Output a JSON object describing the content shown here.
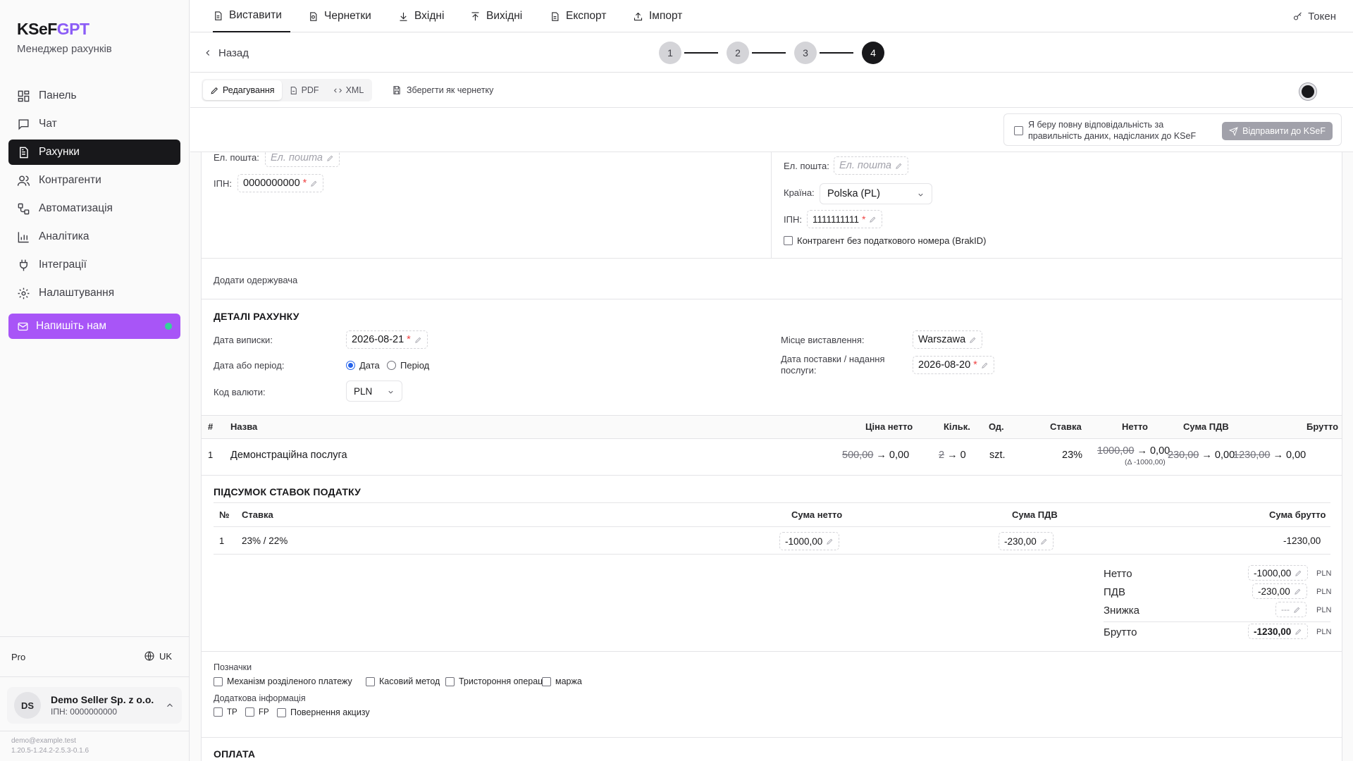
{
  "brand": {
    "name_a": "KSeF",
    "name_b": "GPT",
    "subtitle": "Менеджер рахунків"
  },
  "nav": {
    "items": [
      {
        "label": "Панель",
        "icon": "dashboard-icon"
      },
      {
        "label": "Чат",
        "icon": "chat-icon"
      },
      {
        "label": "Рахунки",
        "icon": "invoice-icon",
        "active": true
      },
      {
        "label": "Контрагенти",
        "icon": "users-icon"
      },
      {
        "label": "Автоматизація",
        "icon": "workflow-icon"
      },
      {
        "label": "Аналітика",
        "icon": "chart-icon"
      },
      {
        "label": "Інтеграції",
        "icon": "plug-icon"
      },
      {
        "label": "Налаштування",
        "icon": "gear-icon"
      }
    ],
    "write_us": "Напишіть нам"
  },
  "sidebar_footer": {
    "plan": "Pro",
    "lang": "UK",
    "account_initials": "DS",
    "account_name": "Demo Seller Sp. z o.o.",
    "account_tax": "ІПН: 0000000000",
    "email": "demo@example.test",
    "version": "1.20.5-1.24.2-2.5.3-0.1.6"
  },
  "tabs": [
    {
      "label": "Виставити",
      "active": true
    },
    {
      "label": "Чернетки"
    },
    {
      "label": "Вхідні"
    },
    {
      "label": "Вихідні"
    },
    {
      "label": "Експорт"
    },
    {
      "label": "Імпорт"
    }
  ],
  "token_label": "Токен",
  "back_label": "Назад",
  "steps": [
    "1",
    "2",
    "3",
    "4"
  ],
  "current_step": 4,
  "view": {
    "edit": "Редагування",
    "pdf": "PDF",
    "xml": "XML",
    "save_draft": "Зберегти як чернетку"
  },
  "action": {
    "responsibility": "Я беру повну відповідальність за правильність даних, надісланих до KSeF",
    "send": "Відправити до KSeF"
  },
  "seller": {
    "email_label": "Ел. пошта:",
    "email_placeholder": "Ел. пошта",
    "tax_label": "ІПН:",
    "tax_value": "0000000000"
  },
  "buyer": {
    "email_label": "Ел. пошта:",
    "email_placeholder": "Ел. пошта",
    "country_label": "Країна:",
    "country_value": "Polska (PL)",
    "tax_label": "ІПН:",
    "tax_value": "1111111111",
    "no_tax_label": "Контрагент без податкового номера (BrakID)"
  },
  "add_recipient": "Додати одержувача",
  "details": {
    "title": "ДЕТАЛІ РАХУНКУ",
    "issue_date_label": "Дата виписки:",
    "issue_date": "2026-08-21",
    "date_or_period_label": "Дата або період:",
    "opt_date": "Дата",
    "opt_period": "Період",
    "currency_label": "Код валюти:",
    "currency": "PLN",
    "place_label": "Місце виставлення:",
    "place": "Warszawa",
    "delivery_label_1": "Дата поставки / надання",
    "delivery_label_2": "послуги:",
    "delivery_date": "2026-08-20"
  },
  "items_table": {
    "headers": [
      "#",
      "Назва",
      "Ціна нетто",
      "Кільк.",
      "Од.",
      "Ставка",
      "Нетто",
      "Сума ПДВ",
      "Брутто"
    ],
    "rows": [
      {
        "n": "1",
        "name": "Демонстраційна послуга",
        "price_old": "500,00",
        "price_new": "0,00",
        "qty_old": "2",
        "qty_new": "0",
        "unit": "szt.",
        "rate": "23%",
        "net_old": "1000,00",
        "net_new": "0,00",
        "net_delta": "(Δ -1000,00)",
        "vat_old": "230,00",
        "vat_new": "0,00",
        "gross_old": "1230,00",
        "gross_new": "0,00"
      }
    ]
  },
  "tax_summary": {
    "title": "ПІДСУМОК СТАВОК ПОДАТКУ",
    "headers": [
      "№",
      "Ставка",
      "Сума нетто",
      "Сума ПДВ",
      "Сума брутто"
    ],
    "rows": [
      {
        "n": "1",
        "rate": "23% / 22%",
        "net": "-1000,00",
        "vat": "-230,00",
        "gross": "-1230,00"
      }
    ]
  },
  "totals": {
    "net_label": "Нетто",
    "net": "-1000,00",
    "vat_label": "ПДВ",
    "vat": "-230,00",
    "discount_label": "Знижка",
    "discount": "---",
    "gross_label": "Брутто",
    "gross": "-1230,00",
    "currency": "PLN"
  },
  "flags": {
    "title": "Позначки",
    "items": [
      "Механізм розділеного платежу",
      "Касовий метод",
      "Тристороння операція",
      "маржа"
    ],
    "extra_title": "Додаткова інформація",
    "extra_items": [
      "TP",
      "FP",
      "Повернення акцизу"
    ]
  },
  "payment_title": "ОПЛАТА",
  "colors": {
    "accent": "#a855f7",
    "brand_gpt": "#8b5cf6",
    "active_nav": "#18181b",
    "status_dot": "#34d399"
  }
}
